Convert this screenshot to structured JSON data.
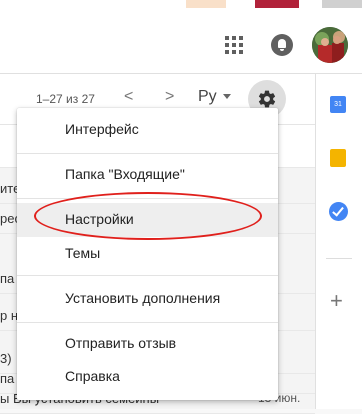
{
  "header": {
    "apps_icon": "apps-grid-icon",
    "notifications_icon": "bell-icon",
    "avatar": "account-avatar"
  },
  "toolbar": {
    "count": "1–27 из 27",
    "prev": "<",
    "next": ">",
    "language": "Ру",
    "settings_icon": "gear-icon"
  },
  "menu": {
    "items": [
      {
        "label": "Интерфейс"
      },
      {
        "label": "Папка \"Входящие\""
      },
      {
        "label": "Настройки"
      },
      {
        "label": "Темы"
      },
      {
        "label": "Установить дополнения"
      },
      {
        "label": "Отправить отзыв"
      },
      {
        "label": "Справка"
      }
    ]
  },
  "list": {
    "rows": [
      {
        "text": "ите"
      },
      {
        "text": "рес"
      },
      {
        "text": "па"
      },
      {
        "text": "р н"
      },
      {
        "text": "3)"
      },
      {
        "text": "па"
      },
      {
        "text": "ы Вы установить семейны",
        "date": "13 июн."
      }
    ]
  },
  "side_panel": {
    "calendar_label": "31",
    "add_label": "+"
  },
  "colors": {
    "highlight": "#e0201c",
    "accent_blue": "#4285f4",
    "keep_yellow": "#f4b400"
  }
}
